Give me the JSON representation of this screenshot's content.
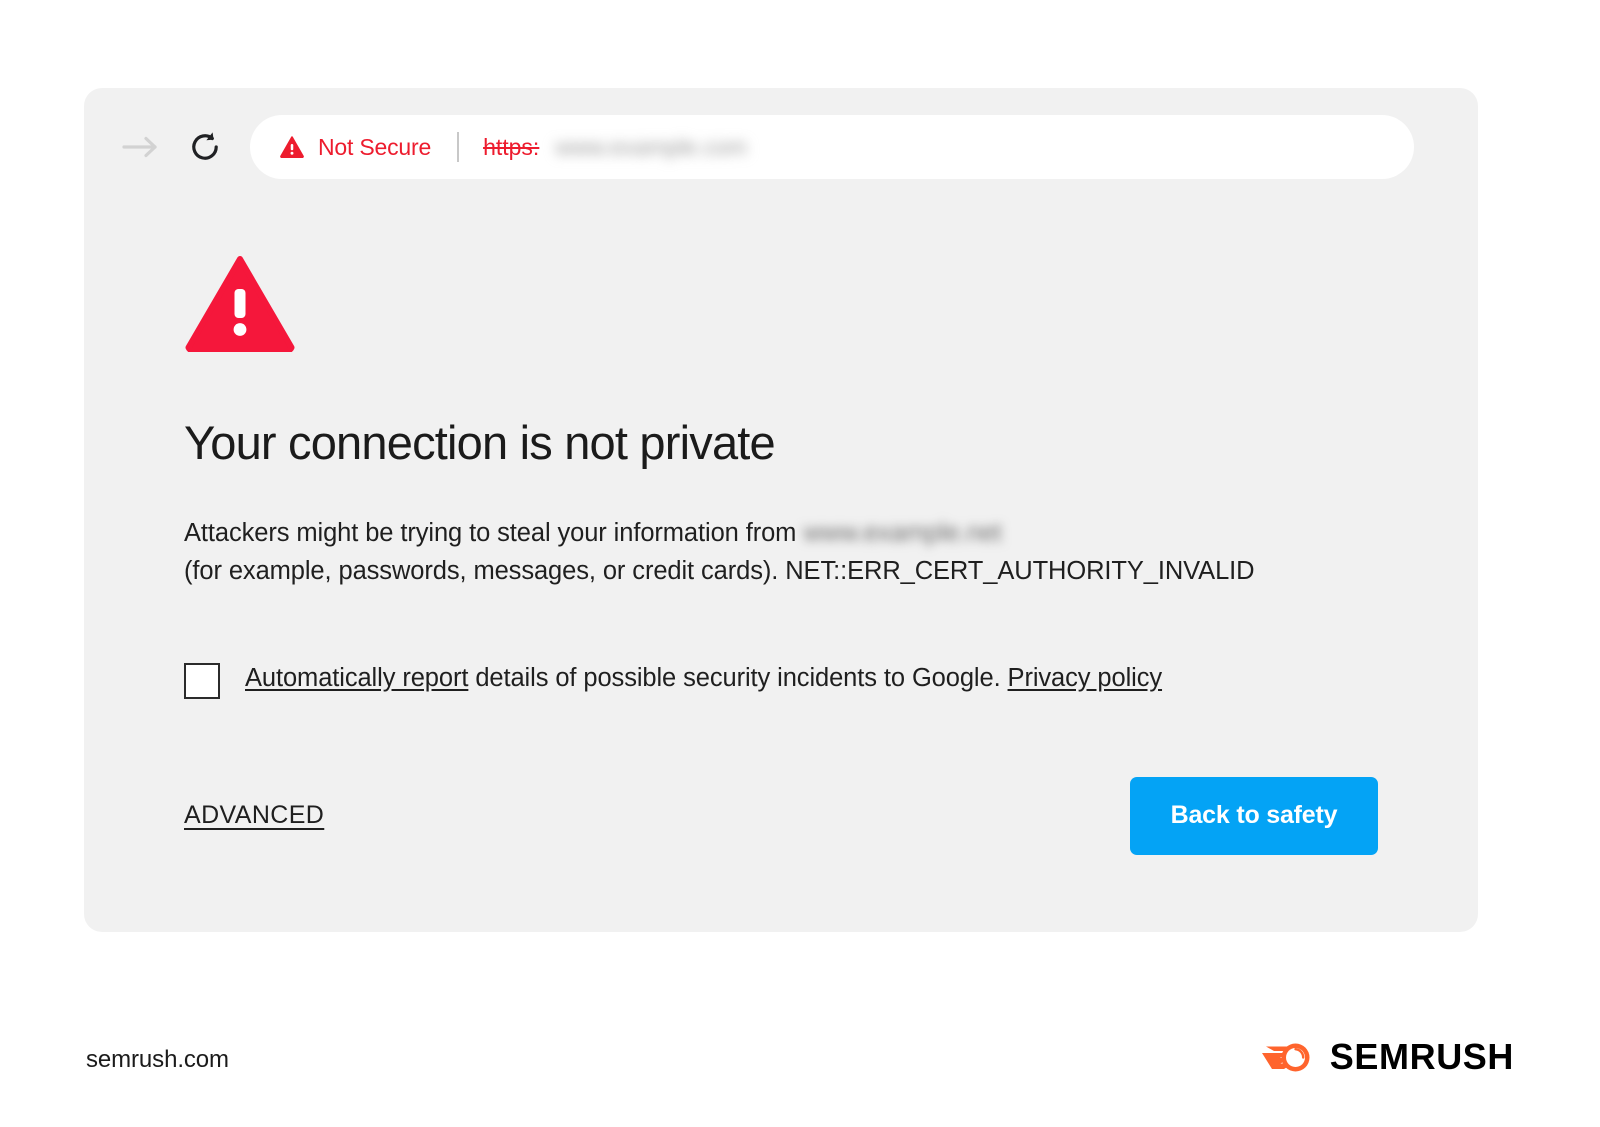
{
  "browser": {
    "toolbar": {
      "forward_icon": "arrow-right-icon",
      "reload_icon": "reload-icon",
      "omnibox": {
        "warning_icon": "warning-triangle-icon",
        "security_label": "Not Secure",
        "scheme": "https:",
        "host_blurred": "www.example.com"
      }
    }
  },
  "error_page": {
    "hero_icon": "warning-triangle-icon",
    "title": "Your connection is not private",
    "paragraph": {
      "lead": "Attackers might be trying to steal your information from",
      "host_blurred": "www.example.net",
      "rest": "(for example, passwords, messages, or credit cards). NET::ERR_CERT_AUTHORITY_INVALID",
      "error_code": "NET::ERR_CERT_AUTHORITY_INVALID"
    },
    "report": {
      "checkbox_checked": "false",
      "link_text": "Automatically report",
      "middle_text": " details of possible security incidents to Google. ",
      "privacy_link": "Privacy policy"
    },
    "actions": {
      "advanced_label": "ADVANCED",
      "back_to_safety_label": "Back to safety"
    }
  },
  "footer": {
    "site_url": "semrush.com",
    "brand_name": "SEMRUSH",
    "brand_mark_icon": "semrush-comet-icon"
  },
  "colors": {
    "danger_red": "#ed1c2e",
    "hero_red": "#f5173b",
    "action_blue": "#04a3f5",
    "brand_orange": "#ff642d",
    "card_gray": "#f1f1f1"
  }
}
